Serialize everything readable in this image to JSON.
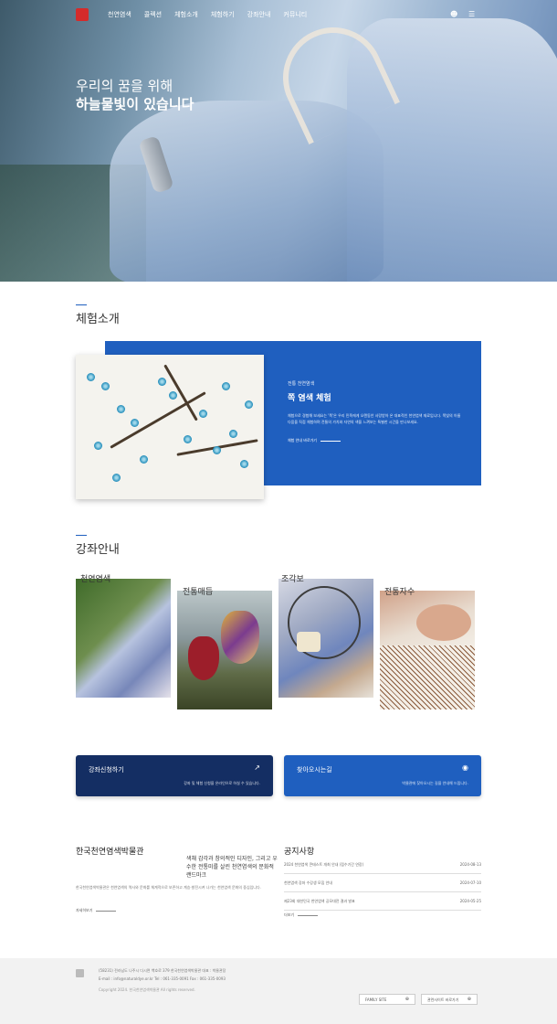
{
  "nav": {
    "menu": [
      "천연염색",
      "콜렉션",
      "체험소개",
      "체험하기",
      "강좌안내",
      "커뮤니티"
    ]
  },
  "hero": {
    "line1": "우리의 꿈을 위해",
    "line2": "하늘물빛이 있습니다"
  },
  "experience": {
    "heading": "체험소개",
    "subtitle": "전통 천연염색",
    "title": "쪽 염색 체험",
    "desc": "체험으로 경험해 보세요는 '쪽'은 우리 민족에게 오랜동안 사랑받아 온 대표적인 천연염색 재료입니다. 쪽빛의 아름다움을 직접 체험하며 전통의 가치와 자연의 색을 느껴보는 특별한 시간을 만나보세요.",
    "more": "체험 안내 바로가기"
  },
  "courses": {
    "heading": "강좌안내",
    "items": [
      "천연염색",
      "전통매듭",
      "조각보",
      "전통자수"
    ]
  },
  "cards": [
    {
      "title": "강좌신청하기",
      "desc": "강좌 및 체험 신청을 온라인으로 하실 수 있습니다.",
      "icon": "external-link-icon"
    },
    {
      "title": "찾아오시는길",
      "desc": "박물관에 찾아오시는 길을 안내해 드립니다.",
      "icon": "location-pin-icon"
    }
  ],
  "museum": {
    "title": "한국천연염색박물관",
    "quote": "색채 감각과 창의적인 디자인, 그리고 우수한 전통미를 살린 천연염색의 문화적 랜드마크",
    "desc": "한국천연염색박물관은 천연염색의 역사와 문화를 체계적으로 보존하고 계승·발전시켜 나가는 천연염색 문화의 중심입니다.",
    "more": "자세히보기"
  },
  "notice": {
    "title": "공지사항",
    "items": [
      {
        "title": "2024 천연염색 콘테스트 개최 안내 (접수기간 연장)",
        "date": "2024-08-13"
      },
      {
        "title": "천연염색 강좌 수강생 모집 안내",
        "date": "2024-07-10"
      },
      {
        "title": "제23회 대한민국 천연염색 공모대전 결과 발표",
        "date": "2024-05-25"
      }
    ],
    "more": "더보기"
  },
  "footer": {
    "line1": "(58231) 전라남도 나주시 다시면 백호로 379 한국천연염색박물관  대표 : 박물관장",
    "line2": "E-mail : info@naturaldye.or.kr   Tel : 061-335-0091   Fax : 061-335-0093",
    "copy": "Copyright 2024. 한국천연염색박물관 All rights reserved.",
    "btn1": "FAMILY SITE",
    "btn2": "관련사이트 바로가기"
  }
}
